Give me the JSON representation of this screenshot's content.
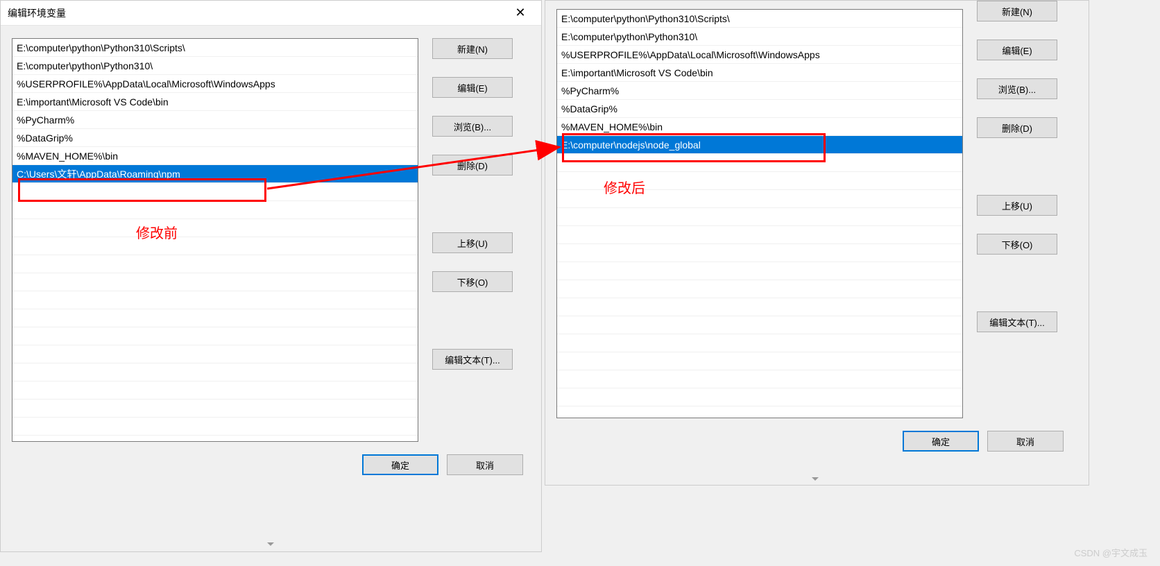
{
  "left_dialog": {
    "title": "编辑环境变量",
    "close_label": "✕",
    "paths": [
      "E:\\computer\\python\\Python310\\Scripts\\",
      "E:\\computer\\python\\Python310\\",
      "%USERPROFILE%\\AppData\\Local\\Microsoft\\WindowsApps",
      "E:\\important\\Microsoft VS Code\\bin",
      "%PyCharm%",
      "%DataGrip%",
      "%MAVEN_HOME%\\bin",
      "C:\\Users\\文轩\\AppData\\Roaming\\npm"
    ],
    "selected_index": 7,
    "buttons": {
      "new": "新建(N)",
      "edit": "编辑(E)",
      "browse": "浏览(B)...",
      "delete": "删除(D)",
      "move_up": "上移(U)",
      "move_down": "下移(O)",
      "edit_text": "编辑文本(T)..."
    },
    "ok": "确定",
    "cancel": "取消"
  },
  "right_dialog": {
    "paths": [
      "E:\\computer\\python\\Python310\\Scripts\\",
      "E:\\computer\\python\\Python310\\",
      "%USERPROFILE%\\AppData\\Local\\Microsoft\\WindowsApps",
      "E:\\important\\Microsoft VS Code\\bin",
      "%PyCharm%",
      "%DataGrip%",
      "%MAVEN_HOME%\\bin",
      "E:\\computer\\nodejs\\node_global"
    ],
    "selected_index": 7,
    "buttons": {
      "new": "新建(N)",
      "edit": "编辑(E)",
      "browse": "浏览(B)...",
      "delete": "删除(D)",
      "move_up": "上移(U)",
      "move_down": "下移(O)",
      "edit_text": "编辑文本(T)..."
    },
    "ok": "确定",
    "cancel": "取消"
  },
  "annotations": {
    "before": "修改前",
    "after": "修改后"
  },
  "watermark": "CSDN @宇文成玉"
}
